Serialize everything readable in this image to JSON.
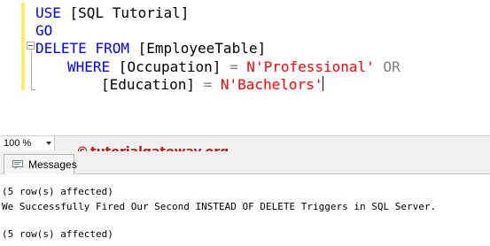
{
  "editor": {
    "line1": {
      "kw": "USE",
      "rest": " [SQL Tutorial]"
    },
    "line2": {
      "kw": "GO"
    },
    "line3": {
      "kw": "DELETE FROM",
      "rest": " [EmployeeTable]"
    },
    "line4": {
      "kw": "WHERE",
      "col": " [Occupation] ",
      "op": "=",
      "str": " N'Professional'",
      "or": " OR"
    },
    "line5": {
      "col": "[Education] ",
      "op": "=",
      "str": " N'Bachelors'"
    }
  },
  "zoom": {
    "value": "100 %"
  },
  "watermark": {
    "copyright": "©",
    "text": "tutorialgateway.org"
  },
  "results": {
    "tab_label": "Messages",
    "lines": [
      "(5 row(s) affected)",
      "We Successfully Fired Our Second INSTEAD OF DELETE Triggers in SQL Server.",
      "(5 row(s) affected)"
    ]
  },
  "colors": {
    "keyword": "#0000ff",
    "string": "#ff0000",
    "operator": "#808080",
    "watermark": "#b81a1a",
    "change_bar": "#ffee62"
  },
  "icons": {
    "messages_tab": "message-icon",
    "zoom_dropdown": "dropdown-arrow-icon"
  }
}
